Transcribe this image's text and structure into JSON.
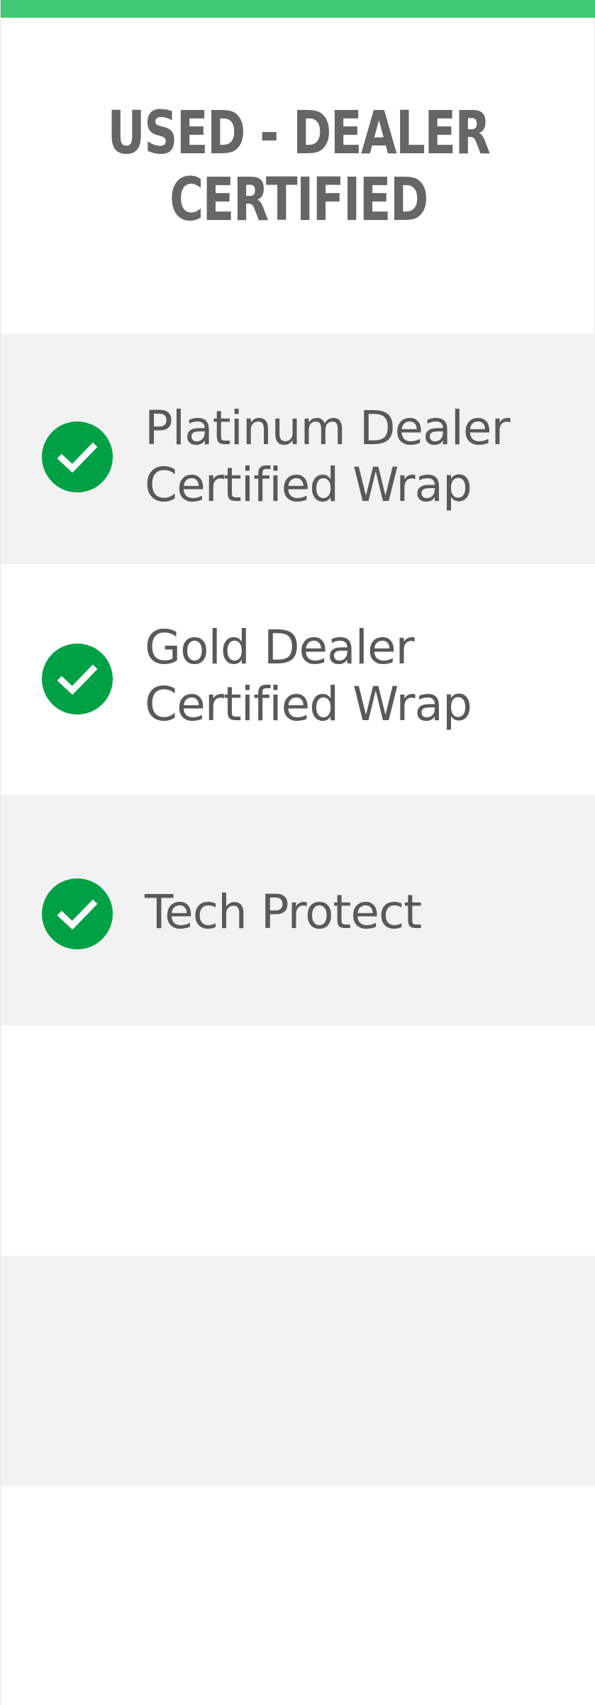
{
  "colors": {
    "accent_bar": "#40c874",
    "check_circle": "#00a046",
    "check_mark": "#ffffff",
    "title_text": "#666666",
    "body_text": "#595959",
    "row_shaded": "#f2f2f2",
    "row_plain": "#ffffff"
  },
  "plan": {
    "title_line1": "USED - DEALER",
    "title_line2": "CERTIFIED"
  },
  "features": [
    {
      "icon": "check-circle-icon",
      "line1": "Platinum Dealer",
      "line2": "Certified Wrap"
    },
    {
      "icon": "check-circle-icon",
      "line1": "Gold Dealer",
      "line2": "Certified Wrap"
    },
    {
      "icon": "check-circle-icon",
      "line1": "Tech Protect",
      "line2": ""
    },
    {
      "icon": "",
      "line1": "",
      "line2": ""
    },
    {
      "icon": "",
      "line1": "",
      "line2": ""
    },
    {
      "icon": "",
      "line1": "",
      "line2": ""
    }
  ]
}
